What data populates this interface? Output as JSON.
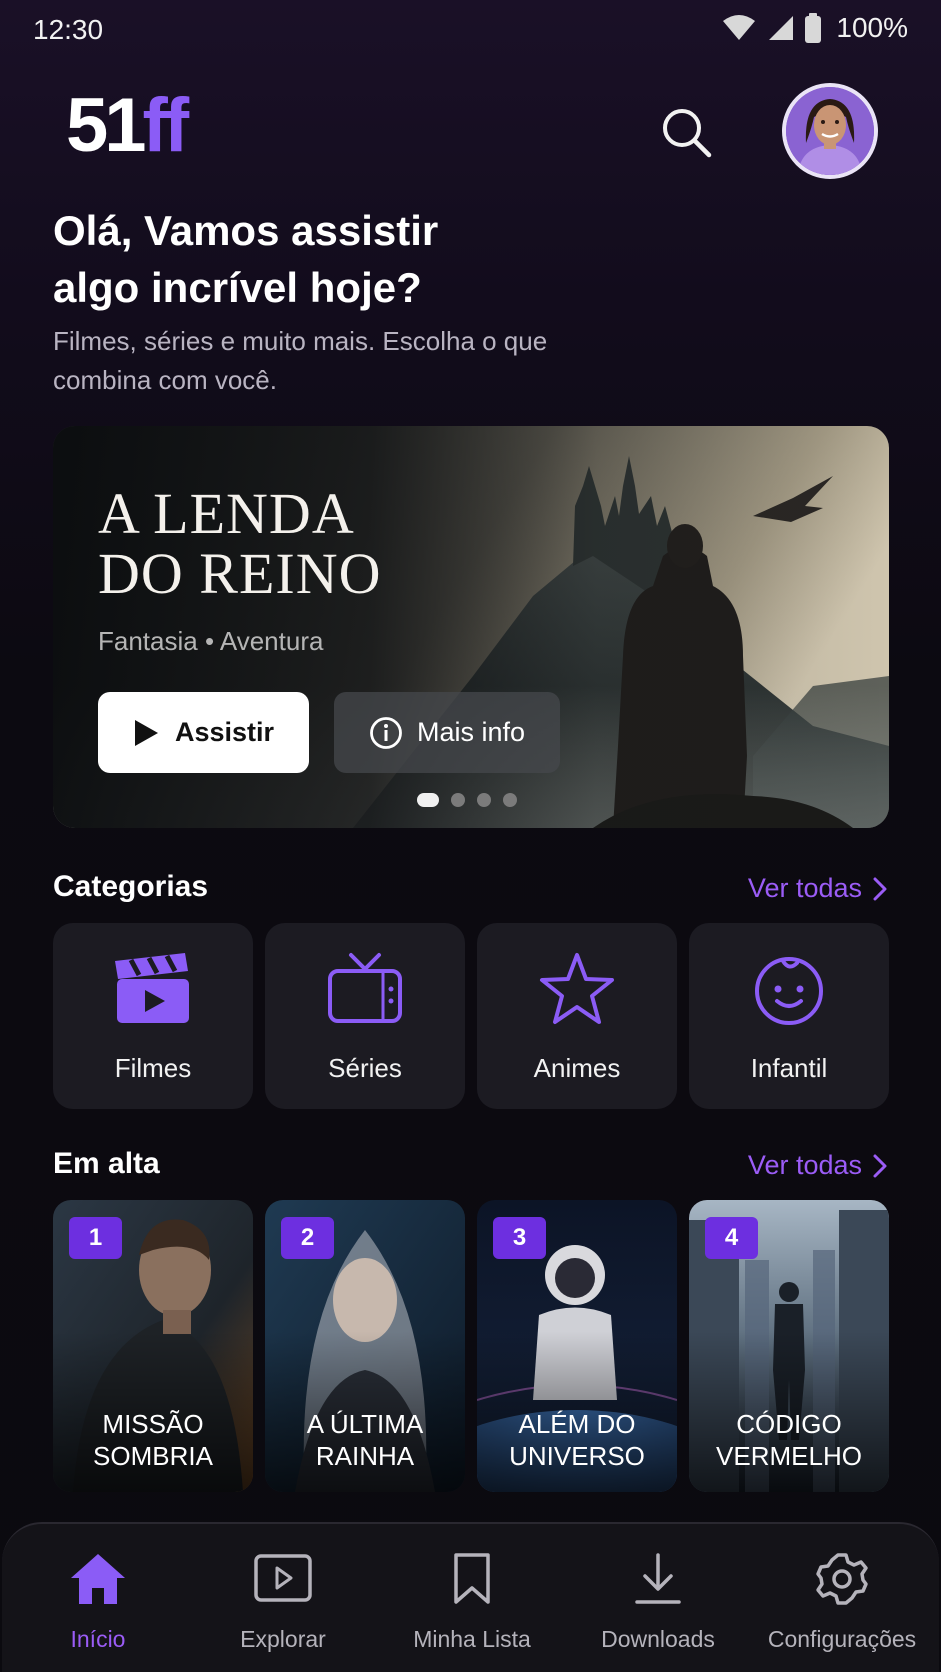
{
  "status_bar": {
    "time": "12:30",
    "battery": "100%",
    "icons": [
      "wifi-icon",
      "signal-icon",
      "battery-icon"
    ]
  },
  "header": {
    "logo_part1": "51",
    "logo_part2": "ff",
    "search_icon": "search-icon",
    "avatar": "profile-avatar"
  },
  "greeting": {
    "line1": "Olá, Vamos assistir",
    "line2": "algo incrível hoje?",
    "sub_line1": "Filmes, séries e muito mais. Escolha o que",
    "sub_line2": "combina com você."
  },
  "hero": {
    "title_line1": "A LENDA",
    "title_line2": "DO REINO",
    "genres": "Fantasia • Aventura",
    "watch_label": "Assistir",
    "info_label": "Mais info",
    "slides": 4,
    "active_slide": 1
  },
  "categories": {
    "title": "Categorias",
    "see_all": "Ver todas",
    "items": [
      {
        "label": "Filmes",
        "icon": "clapperboard-icon"
      },
      {
        "label": "Séries",
        "icon": "tv-icon"
      },
      {
        "label": "Animes",
        "icon": "star-icon"
      },
      {
        "label": "Infantil",
        "icon": "baby-face-icon"
      }
    ]
  },
  "trending": {
    "title": "Em alta",
    "see_all": "Ver todas",
    "items": [
      {
        "rank": "1",
        "line1": "MISSÃO",
        "line2": "SOMBRIA"
      },
      {
        "rank": "2",
        "line1": "A ÚLTIMA",
        "line2": "RAINHA"
      },
      {
        "rank": "3",
        "line1": "ALÉM DO",
        "line2": "UNIVERSO"
      },
      {
        "rank": "4",
        "line1": "CÓDIGO",
        "line2": "VERMELHO"
      }
    ]
  },
  "bottom_nav": {
    "items": [
      {
        "label": "Início",
        "icon": "home-icon",
        "active": true
      },
      {
        "label": "Explorar",
        "icon": "play-square-icon",
        "active": false
      },
      {
        "label": "Minha Lista",
        "icon": "bookmark-icon",
        "active": false
      },
      {
        "label": "Downloads",
        "icon": "download-icon",
        "active": false
      },
      {
        "label": "Configurações",
        "icon": "gear-icon",
        "active": false
      }
    ]
  },
  "colors": {
    "accent": "#8b5cf6",
    "rank_badge": "#6d2fe0",
    "card_bg": "#1c1b22",
    "nav_bg": "#141318"
  }
}
